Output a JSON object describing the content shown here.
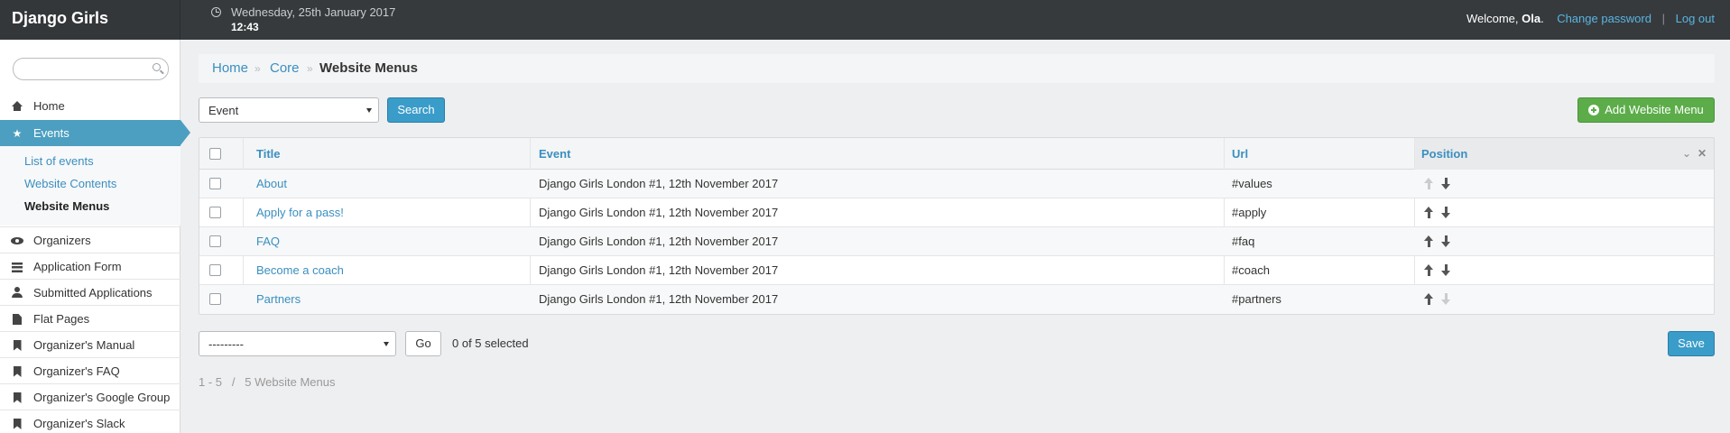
{
  "header": {
    "brand": "Django Girls",
    "date": "Wednesday, 25th January 2017",
    "time": "12:43",
    "welcome": "Welcome,",
    "username": "Ola",
    "change_password": "Change password",
    "separator": "|",
    "logout": "Log out"
  },
  "sidebar": {
    "search_placeholder": "",
    "items": [
      {
        "label": "Home",
        "icon": "home-icon"
      },
      {
        "label": "Events",
        "icon": "star-icon"
      },
      {
        "label": "Organizers",
        "icon": "eye-icon"
      },
      {
        "label": "Application Form",
        "icon": "list-icon"
      },
      {
        "label": "Submitted Applications",
        "icon": "user-icon"
      },
      {
        "label": "Flat Pages",
        "icon": "file-icon"
      },
      {
        "label": "Organizer's Manual",
        "icon": "bookmark-icon"
      },
      {
        "label": "Organizer's FAQ",
        "icon": "bookmark-icon"
      },
      {
        "label": "Organizer's Google Group",
        "icon": "bookmark-icon"
      },
      {
        "label": "Organizer's Slack",
        "icon": "bookmark-icon"
      }
    ],
    "subitems": [
      {
        "label": "List of events"
      },
      {
        "label": "Website Contents"
      },
      {
        "label": "Website Menus"
      }
    ]
  },
  "breadcrumb": {
    "home": "Home",
    "core": "Core",
    "current": "Website Menus",
    "arrow": "»"
  },
  "toolbar": {
    "filter_value": "Event",
    "search_label": "Search",
    "add_label": "Add Website Menu"
  },
  "table": {
    "headers": {
      "title": "Title",
      "event": "Event",
      "url": "Url",
      "position": "Position"
    },
    "rows": [
      {
        "title": "About",
        "event": "Django Girls London #1, 12th November 2017",
        "url": "#values"
      },
      {
        "title": "Apply for a pass!",
        "event": "Django Girls London #1, 12th November 2017",
        "url": "#apply"
      },
      {
        "title": "FAQ",
        "event": "Django Girls London #1, 12th November 2017",
        "url": "#faq"
      },
      {
        "title": "Become a coach",
        "event": "Django Girls London #1, 12th November 2017",
        "url": "#coach"
      },
      {
        "title": "Partners",
        "event": "Django Girls London #1, 12th November 2017",
        "url": "#partners"
      }
    ]
  },
  "actions": {
    "action_value": "---------",
    "go_label": "Go",
    "selected_text": "0 of 5 selected",
    "save_label": "Save"
  },
  "pagination": {
    "text": "1 - 5   /   5 Website Menus"
  }
}
